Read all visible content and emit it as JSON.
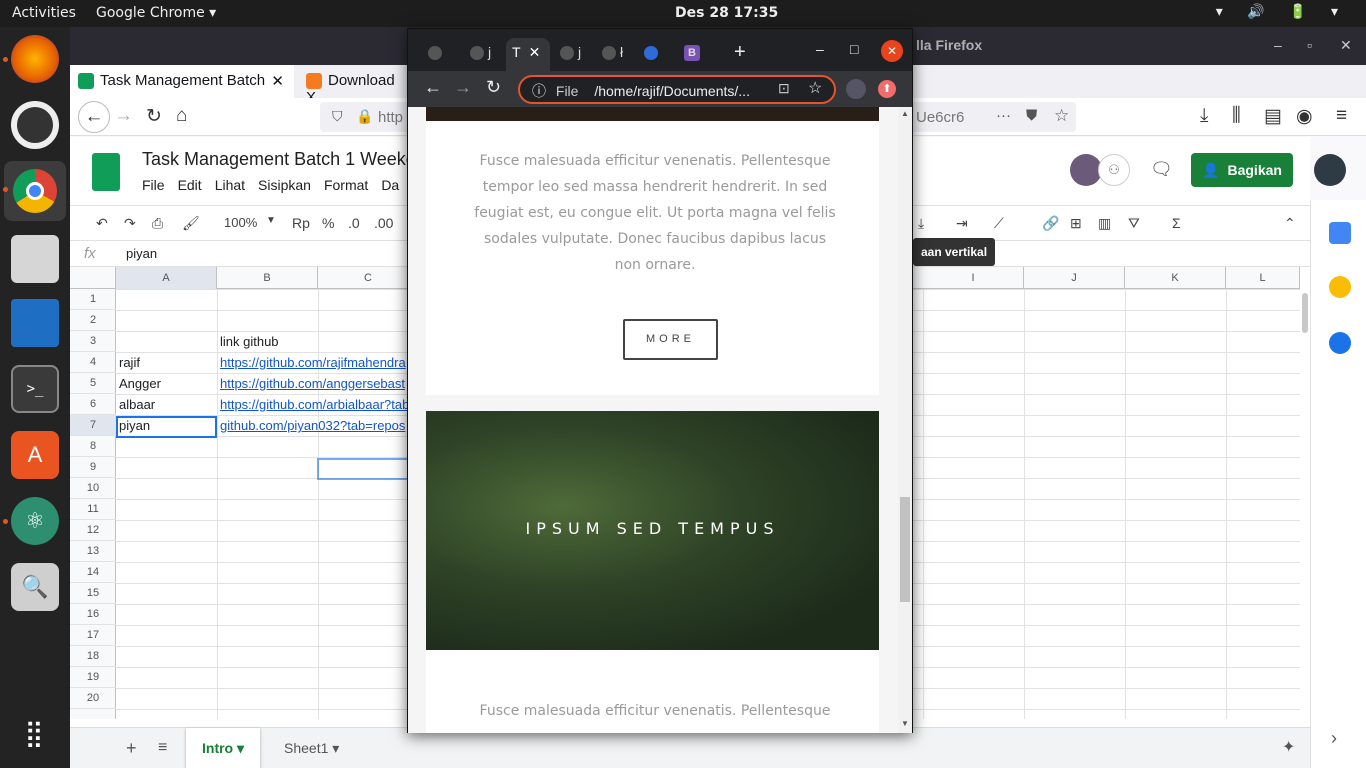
{
  "topbar": {
    "activities": "Activities",
    "app": "Google Chrome ▾",
    "clock": "Des 28  17:35",
    "tray": "▾ 🔊 🔋 ▾"
  },
  "firefox": {
    "title": "lla Firefox",
    "tabs": [
      {
        "label": "Task Management Batch"
      },
      {
        "label": "Download X"
      }
    ],
    "url_partial": "http",
    "url_right": "Ue6cr6"
  },
  "sheets": {
    "title": "Task Management Batch 1 Weeke",
    "menus": [
      "File",
      "Edit",
      "Lihat",
      "Sisipkan",
      "Format",
      "Da"
    ],
    "share": "Bagikan",
    "zoom": "100%",
    "currency": "Rp",
    "percent": "%",
    "dec_less": ".0",
    "dec_more": ".00",
    "tooltip": "aan vertikal",
    "fx_value": "piyan",
    "columns": [
      "A",
      "B",
      "C",
      "I",
      "J",
      "K",
      "L"
    ],
    "rows": [
      "1",
      "2",
      "3",
      "4",
      "5",
      "6",
      "7",
      "8",
      "9",
      "10",
      "11",
      "12",
      "13",
      "14",
      "15",
      "16",
      "17",
      "18",
      "19",
      "20"
    ],
    "cells": {
      "b3": "link github",
      "a4": "rajif",
      "b4": "https://github.com/rajifmahendra",
      "a5": "Angger",
      "b5": "https://github.com/anggersebast",
      "a6": "albaar",
      "b6": "https://github.com/arbialbaar?tab",
      "a7": "piyan",
      "b7": "github.com/piyan032?tab=repos"
    },
    "sheet_tabs": [
      "Intro ▾",
      "Sheet1 ▾"
    ]
  },
  "chrome": {
    "tabs": [
      "j",
      "T",
      "j",
      "ł",
      "B"
    ],
    "new_tab": "+",
    "omnibox_scheme": "File",
    "omnibox_path": "/home/rajif/Documents/...",
    "paragraph1": "Fusce malesuada efficitur venenatis. Pellentesque tempor leo sed massa hendrerit hendrerit. In sed feugiat est, eu congue elit. Ut porta magna vel felis sodales vulputate. Donec faucibus dapibus lacus non ornare.",
    "more": "MORE",
    "image_caption": "IPSUM SED TEMPUS",
    "paragraph2": "Fusce malesuada efficitur venenatis. Pellentesque"
  },
  "colors": {
    "sheets_green": "#188038",
    "link": "#1155cc",
    "omnibox_ring": "#e8532a"
  }
}
